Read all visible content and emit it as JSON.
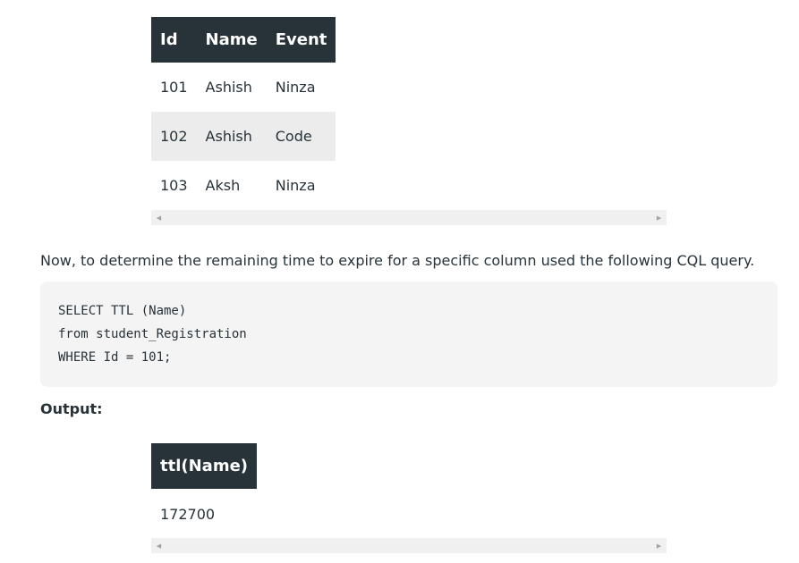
{
  "table1": {
    "headers": [
      "Id",
      "Name",
      "Event"
    ],
    "rows": [
      [
        "101",
        "Ashish",
        "Ninza"
      ],
      [
        "102",
        "Ashish",
        "Code"
      ],
      [
        "103",
        "Aksh",
        "Ninza"
      ]
    ]
  },
  "paragraph": "Now, to determine the remaining time to expire for a specific column used the following CQL query.",
  "code": {
    "lines": [
      "SELECT TTL (Name)",
      "from student_Registration",
      "WHERE Id = 101;"
    ]
  },
  "output_label": "Output:",
  "table2": {
    "headers": [
      "ttl(Name)"
    ],
    "rows": [
      [
        "172700"
      ]
    ]
  },
  "icons": {
    "scroll_left": "scroll-left-arrow-icon",
    "scroll_right": "scroll-right-arrow-icon"
  },
  "colors": {
    "header_bg": "#273239",
    "header_text": "#ffffff",
    "alt_row_bg": "#ececec",
    "code_bg": "#f4f4f4"
  }
}
